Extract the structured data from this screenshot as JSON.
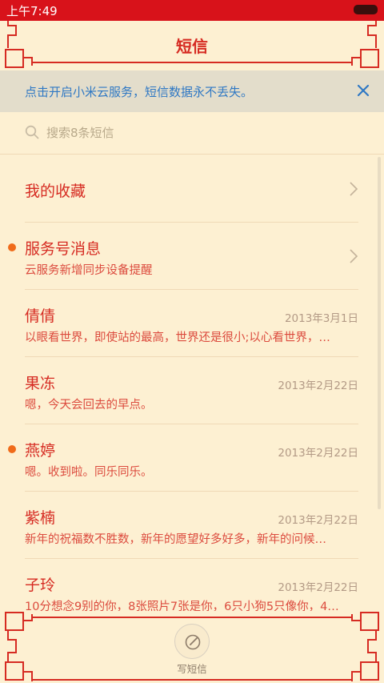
{
  "status_bar": {
    "time": "上午7:49"
  },
  "header": {
    "title": "短信"
  },
  "banner": {
    "text": "点击开启小米云服务，短信数据永不丢失。"
  },
  "search": {
    "placeholder": "搜索8条短信"
  },
  "list": {
    "favorites": {
      "title": "我的收藏"
    },
    "service": {
      "title": "服务号消息",
      "preview": "云服务新增同步设备提醒",
      "unread": true
    },
    "conversations": [
      {
        "name": "倩倩",
        "date": "2013年3月1日",
        "preview": "以眼看世界，即使站的最高，世界还是很小;以心看世界，…",
        "unread": false
      },
      {
        "name": "果冻",
        "date": "2013年2月22日",
        "preview": "嗯，今天会回去的早点。",
        "unread": false
      },
      {
        "name": "燕婷",
        "date": "2013年2月22日",
        "preview": "嗯。收到啦。同乐同乐。",
        "unread": true
      },
      {
        "name": "紫楠",
        "date": "2013年2月22日",
        "preview": "新年的祝福数不胜数，新年的愿望好多好多，新年的问候…",
        "unread": false
      },
      {
        "name": "子玲",
        "date": "2013年2月22日",
        "preview": "10分想念9别的你，8张照片7张是你，6只小狗5只像你，4…",
        "unread": false
      }
    ]
  },
  "footer": {
    "compose_label": "写短信"
  },
  "colors": {
    "status_bar": "#d8121a",
    "background": "#fdf0d2",
    "accent_red": "#d62b22",
    "banner_bg": "#e3ddcb",
    "banner_text": "#2f78c4",
    "unread_dot": "#f06b1a"
  }
}
